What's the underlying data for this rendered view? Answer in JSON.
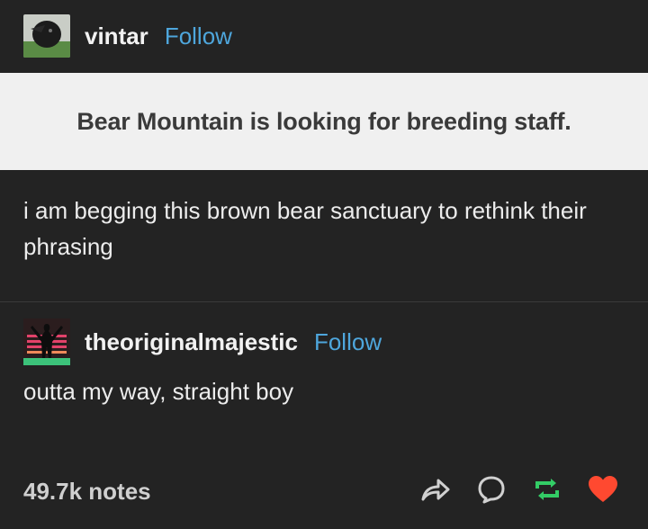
{
  "post": {
    "author": "vintar",
    "follow_label": "Follow",
    "quote": "Bear Mountain is looking for breeding staff.",
    "body": "i am begging this brown bear sanctuary to rethink their phrasing"
  },
  "reply": {
    "author": "theoriginalmajestic",
    "follow_label": "Follow",
    "text": "outta my way, straight boy"
  },
  "footer": {
    "notes": "49.7k notes"
  },
  "icons": {
    "share": "share-icon",
    "reply": "reply-icon",
    "reblog": "reblog-icon",
    "like": "heart-icon"
  },
  "colors": {
    "follow": "#4ea6dc",
    "reblog": "#33cc66",
    "like": "#ff4930",
    "background": "#232323"
  }
}
